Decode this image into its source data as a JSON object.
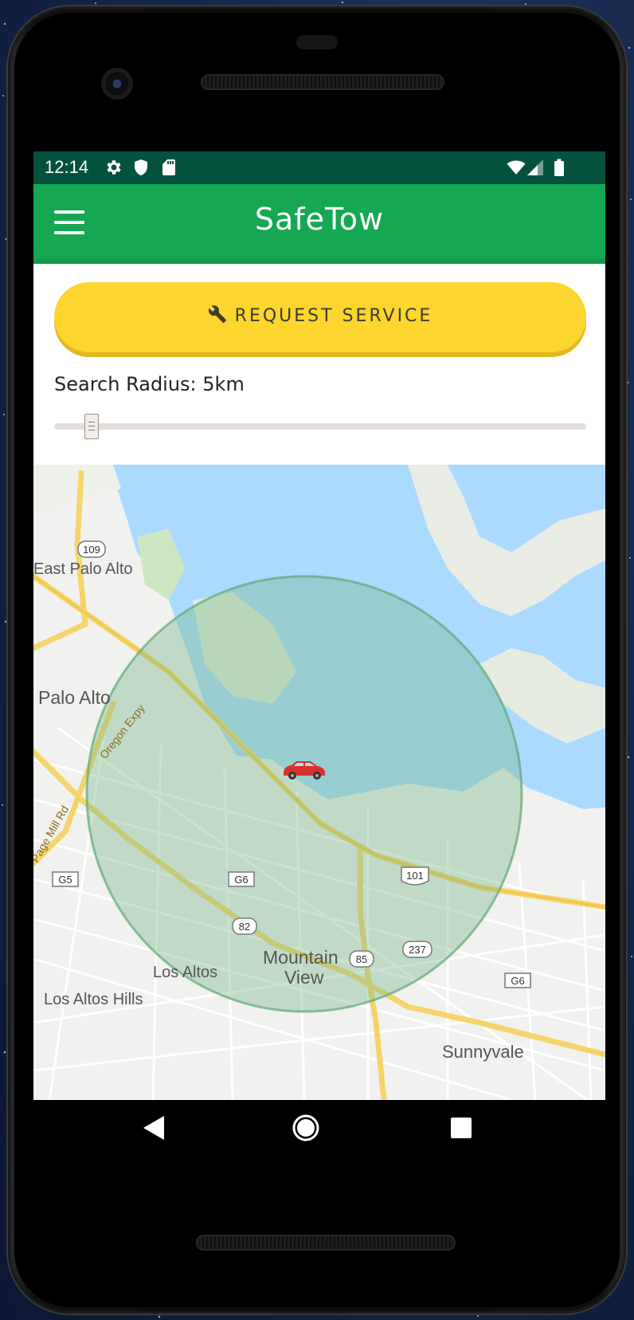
{
  "status_bar": {
    "time": "12:14",
    "left_icons": [
      "gear-icon",
      "shield-icon",
      "sd-card-icon"
    ],
    "right_icons": [
      "wifi-icon",
      "signal-icon",
      "battery-icon"
    ]
  },
  "app_bar": {
    "title": "SafeTow",
    "menu_icon": "hamburger-menu-icon"
  },
  "request_button": {
    "label": "REQUEST SERVICE",
    "icon": "wrench-icon"
  },
  "search_radius": {
    "label": "Search Radius: 5km",
    "slider_value_fraction": 0.07
  },
  "map": {
    "place_labels": [
      "East Palo Alto",
      "Palo Alto",
      "Oregon Expy",
      "Page Mill Rd",
      "Mountain",
      "View",
      "Los Altos",
      "Los Altos Hills",
      "Sunnyvale"
    ],
    "route_shields": [
      "109",
      "G5",
      "G6",
      "82",
      "85",
      "237",
      "101",
      "G6"
    ],
    "marker": "car-icon"
  },
  "nav_bar": {
    "back": "back-icon",
    "home": "home-icon",
    "recents": "recents-icon"
  },
  "colors": {
    "status_bar": "#04523e",
    "app_bar": "#16a753",
    "request_button": "#fcd52f",
    "water": "#aadaff",
    "radius_circle": "#7ab98c"
  }
}
